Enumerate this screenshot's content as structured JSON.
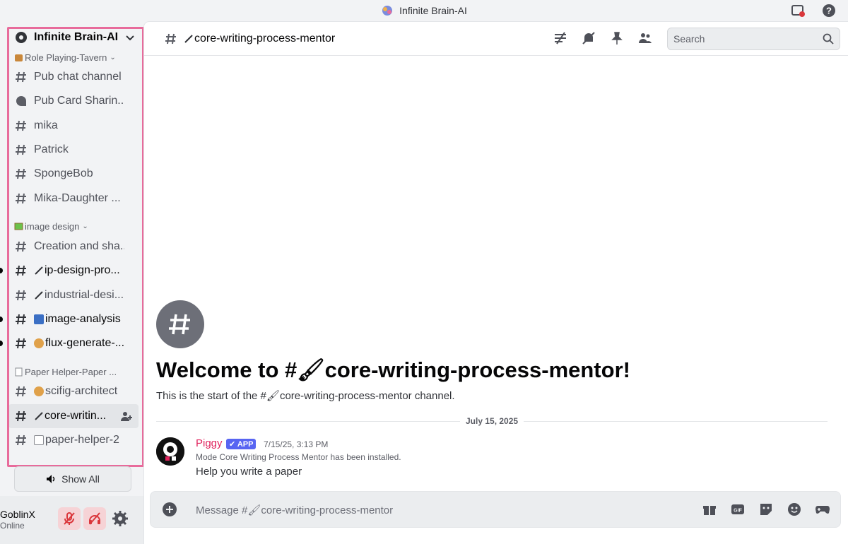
{
  "window": {
    "title": "Infinite Brain-AI"
  },
  "server": {
    "name": "Infinite Brain-AI"
  },
  "categories": [
    {
      "name": "Role Playing-Tavern",
      "channels": [
        {
          "label": "Pub chat channel",
          "type": "text"
        },
        {
          "label": "Pub Card Sharin...",
          "type": "forum"
        },
        {
          "label": "mika",
          "type": "text"
        },
        {
          "label": "Patrick",
          "type": "text"
        },
        {
          "label": "SpongeBob",
          "type": "text"
        },
        {
          "label": "Mika-Daughter ...",
          "type": "text"
        }
      ]
    },
    {
      "name": "image design",
      "channels": [
        {
          "label": "Creation and sha...",
          "type": "text"
        },
        {
          "label": "ip-design-pro...",
          "type": "text"
        },
        {
          "label": "industrial-desi...",
          "type": "text"
        },
        {
          "label": "image-analysis",
          "type": "text"
        },
        {
          "label": "flux-generate-...",
          "type": "text"
        }
      ]
    },
    {
      "name": "Paper Helper-Paper ...",
      "channels": [
        {
          "label": "scifig-architect",
          "type": "text"
        },
        {
          "label": "core-writin...",
          "type": "text"
        },
        {
          "label": "paper-helper-2",
          "type": "text"
        }
      ]
    }
  ],
  "show_all_label": "Show All",
  "user": {
    "name": "GoblinX",
    "status": "Online"
  },
  "header": {
    "channel_name": "core-writing-process-mentor",
    "search_placeholder": "Search"
  },
  "welcome": {
    "title": "Welcome to #🖌core-writing-process-mentor!",
    "subtitle": "This is the start of the #🖌core-writing-process-mentor channel."
  },
  "date_divider": "July 15, 2025",
  "message": {
    "author": "Piggy",
    "badge": "✔ APP",
    "timestamp": "7/15/25, 3:13 PM",
    "system_line": "Mode Core Writing Process Mentor has been installed.",
    "content": "Help you write a paper"
  },
  "composer": {
    "placeholder": "Message #🖌core-writing-process-mentor"
  },
  "colors": {
    "highlight": "#e86b9b",
    "author": "#e0245e",
    "badge": "#5865f2"
  }
}
